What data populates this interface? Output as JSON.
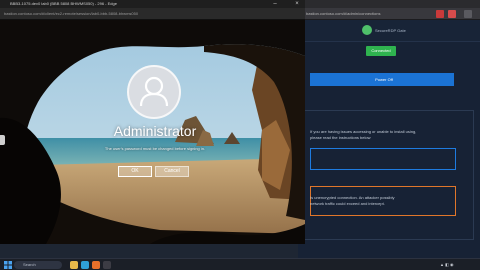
{
  "remote_window": {
    "title": "BBB3-1075.dev0 lab0 (BBB 5808 BHWMS050) - 296 - Edge",
    "url": "bastion.contoso.com/#/client/ec2-remote/session/lab0-bbb-5808-bhwms050"
  },
  "lock_screen": {
    "username": "Administrator",
    "message": "The user's password must be changed before signing in.",
    "ok_label": "OK",
    "cancel_label": "Cancel"
  },
  "background_app": {
    "brand": "SecureRDP Gate",
    "url": "bastion.contoso.com/#/admin/connections",
    "status_badge": "Connected",
    "action_button": "Power Off",
    "notice_text_1": "If you are having issues accessing or unable to install using,",
    "notice_text_2": "please read the instructions below",
    "warning_text_1": "Is unencrypted connection. An attacker possibly",
    "warning_text_2": "network traffic could exceed and intercept."
  },
  "taskbar": {
    "search_placeholder": "Search"
  },
  "colors": {
    "connected": "#2fb34f",
    "primary_button": "#1b73d4",
    "warning_border": "#e0762a",
    "info_border": "#1e7be0"
  }
}
